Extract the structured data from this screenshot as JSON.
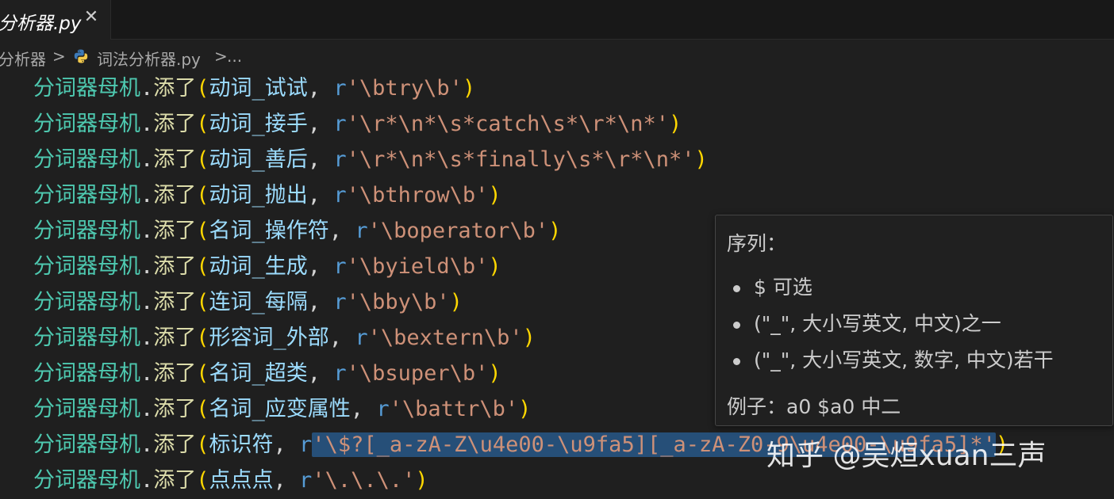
{
  "tab": {
    "title": "分析器.py",
    "close_glyph": "✕"
  },
  "breadcrumb": {
    "folder": "分析器",
    "sep1": ">",
    "file": "词法分析器.py",
    "sep2": ">",
    "more": "..."
  },
  "code": {
    "object": "分词器母机",
    "method": "添了",
    "lines": [
      {
        "name": "动词_试试",
        "pre": "r",
        "pattern": "'\\btry\\b'"
      },
      {
        "name": "动词_接手",
        "pre": "r",
        "pattern": "'\\r*\\n*\\s*catch\\s*\\r*\\n*'"
      },
      {
        "name": "动词_善后",
        "pre": "r",
        "pattern": "'\\r*\\n*\\s*finally\\s*\\r*\\n*'"
      },
      {
        "name": "动词_抛出",
        "pre": "r",
        "pattern": "'\\bthrow\\b'"
      },
      {
        "name": "名词_操作符",
        "pre": "r",
        "pattern": "'\\boperator\\b'"
      },
      {
        "name": "动词_生成",
        "pre": "r",
        "pattern": "'\\byield\\b'"
      },
      {
        "name": "连词_每隔",
        "pre": "r",
        "pattern": "'\\bby\\b'"
      },
      {
        "name": "形容词_外部",
        "pre": "r",
        "pattern": "'\\bextern\\b'"
      },
      {
        "name": "名词_超类",
        "pre": "r",
        "pattern": "'\\bsuper\\b'"
      },
      {
        "name": "名词_应变属性",
        "pre": "r",
        "pattern": "'\\battr\\b'"
      },
      {
        "name": "标识符",
        "pre": "r",
        "pattern": "'\\$?[_a-zA-Z\\u4e00-\\u9fa5][_a-zA-Z0-9\\u4e00-\\u9fa5]*'"
      },
      {
        "name": "点点点",
        "pre": "r",
        "pattern": "'\\.\\.\\.'"
      }
    ]
  },
  "hover": {
    "title": "序列：",
    "items": [
      "$ 可选",
      "(\"_\", 大小写英文, 中文)之一",
      "(\"_\", 大小写英文, 数字, 中文)若干"
    ],
    "example": "例子：a0 $a0 中二"
  },
  "watermark": "知乎 @吴烜xuan三声",
  "colors": {
    "background": "#1f1f1f",
    "object": "#4ec9b0",
    "method": "#dcdcaa",
    "paren": "#ffd700",
    "variable": "#9cdcfe",
    "string": "#ce9178",
    "prefix": "#569cd6",
    "selection": "#264f78"
  },
  "icons": {
    "breadcrumb_file": "python-icon",
    "tab_close": "close-icon"
  }
}
